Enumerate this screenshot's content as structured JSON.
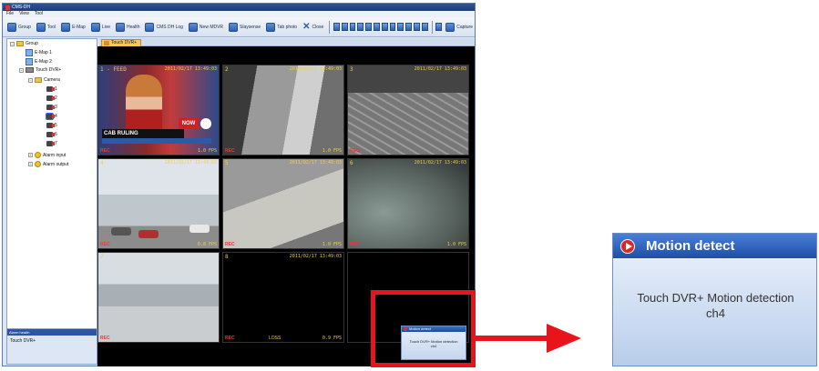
{
  "window": {
    "title": "CMS-DH"
  },
  "menu": [
    "File",
    "View",
    "Tool"
  ],
  "toolbar": {
    "buttons": [
      "Group",
      "Tool",
      "E-Map",
      "Live",
      "Health",
      "CMS DH Log",
      "New MDVR",
      "Slaysense",
      "Tab photo"
    ],
    "close_label": "Close",
    "capture_label": "Capture"
  },
  "tree": {
    "group": "Group",
    "emap1": "E-Map 1",
    "emap2": "E-Map 2",
    "dvr": "Touch DVR+",
    "camera": "Camera",
    "channels": [
      "1",
      "2",
      "3",
      "4",
      "5",
      "6",
      "7"
    ],
    "alarm_input": "Alarm input",
    "alarm_output": "Alarm output"
  },
  "status_panel": {
    "header": "Alarm health",
    "value": "Touch DVR+"
  },
  "video_tab": "Touch DVR+",
  "cells": [
    {
      "num": "1 - FEED",
      "ts": "2011/02/17 13:49:03",
      "rec": "REC",
      "fps": "1.0 FPS"
    },
    {
      "num": "2",
      "ts": "2011/02/17 13:49:03",
      "rec": "REC",
      "fps": "1.0 FPS"
    },
    {
      "num": "3",
      "ts": "2011/02/17 13:49:03",
      "rec": "REC",
      "fps": ""
    },
    {
      "num": "4",
      "ts": "2011/02/17 13:49:03",
      "rec": "REC",
      "fps": "0.8 FPS"
    },
    {
      "num": "5",
      "ts": "2011/02/17 13:49:03",
      "rec": "REC",
      "fps": "1.0 FPS"
    },
    {
      "num": "6",
      "ts": "2011/02/17 13:49:03",
      "rec": "REC",
      "fps": "1.0 FPS"
    },
    {
      "num": "7",
      "ts": "",
      "rec": "REC",
      "fps": ""
    },
    {
      "num": "8",
      "ts": "2011/02/17 13:49:03",
      "rec": "REC",
      "fps": "0.9 FPS",
      "loss": "LOSS"
    }
  ],
  "news_overlay": {
    "lower_third": "CAB RULING",
    "badge": "NOW"
  },
  "popup": {
    "title": "Motion detect",
    "line1": "Touch DVR+ Motion detection",
    "line2": "ch4",
    "small_line1": "Touch DVR+ Motion detection",
    "small_line2": "ch4"
  },
  "colors": {
    "callout_red": "#e8141b",
    "title_blue": "#1e4fa6"
  }
}
